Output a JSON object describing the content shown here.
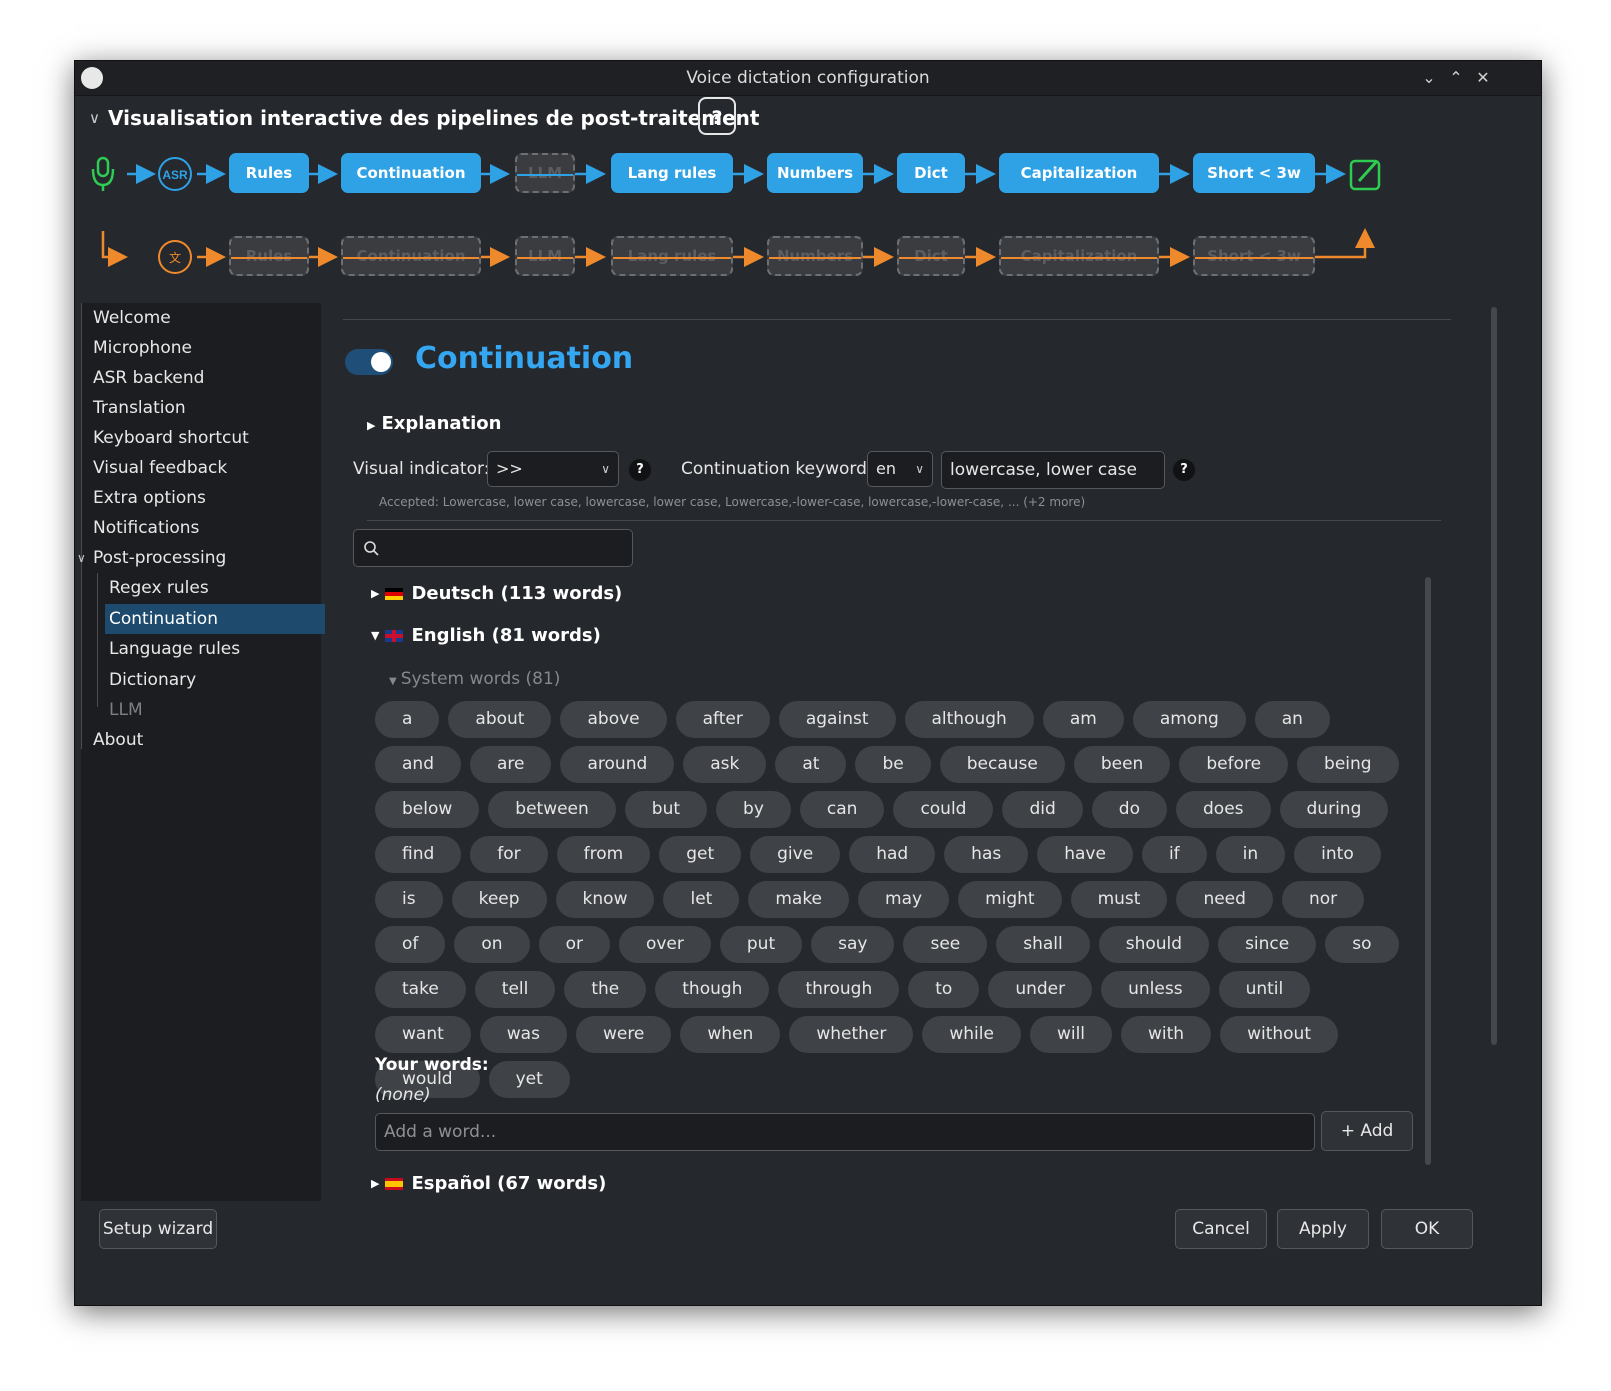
{
  "window": {
    "title": "Voice dictation configuration"
  },
  "pipeline": {
    "title": "Visualisation interactive des pipelines de post-traitement",
    "help": "?",
    "asr_label": "ASR",
    "main_stages": [
      "Rules",
      "Continuation",
      "LLM",
      "Lang rules",
      "Numbers",
      "Dict",
      "Capitalization",
      "Short < 3w"
    ],
    "main_stage_enabled": [
      true,
      true,
      false,
      true,
      true,
      true,
      true,
      true
    ],
    "translation_stages": [
      "Rules",
      "Continuation",
      "LLM",
      "Lang rules",
      "Numbers",
      "Dict",
      "Capitalization",
      "Short < 3w"
    ],
    "colors": {
      "main": "#2fa2e6",
      "translation": "#ef8a2c",
      "mic": "#2ecc52"
    }
  },
  "sidebar": {
    "items": [
      "Welcome",
      "Microphone",
      "ASR backend",
      "Translation",
      "Keyboard shortcut",
      "Visual feedback",
      "Extra options",
      "Notifications",
      "Post-processing"
    ],
    "post_processing_children": [
      "Regex rules",
      "Continuation",
      "Language rules",
      "Dictionary",
      "LLM"
    ],
    "after": [
      "About"
    ],
    "selected": "Continuation"
  },
  "section": {
    "title": "Continuation",
    "enabled": true,
    "explanation": "Explanation",
    "visual_indicator_label": "Visual indicator:",
    "visual_indicator_value": ">>",
    "keyword_label": "Continuation keyword:",
    "keyword_lang": "en",
    "keyword_value": "lowercase, lower case",
    "accepted": "Accepted: Lowercase, lower case, lowercase, lower case, Lowercase,-lower-case, lowercase,-lower-case, ... (+2 more)"
  },
  "languages": {
    "deutsch": "Deutsch (113 words)",
    "english": "English (81 words)",
    "system_words": "System words (81)",
    "espanol": "Español (67 words)"
  },
  "english_words": [
    "a",
    "about",
    "above",
    "after",
    "against",
    "although",
    "am",
    "among",
    "an",
    "and",
    "are",
    "around",
    "ask",
    "at",
    "be",
    "because",
    "been",
    "before",
    "being",
    "below",
    "between",
    "but",
    "by",
    "can",
    "could",
    "did",
    "do",
    "does",
    "during",
    "find",
    "for",
    "from",
    "get",
    "give",
    "had",
    "has",
    "have",
    "if",
    "in",
    "into",
    "is",
    "keep",
    "know",
    "let",
    "make",
    "may",
    "might",
    "must",
    "need",
    "nor",
    "of",
    "on",
    "or",
    "over",
    "put",
    "say",
    "see",
    "shall",
    "should",
    "since",
    "so",
    "take",
    "tell",
    "the",
    "though",
    "through",
    "to",
    "under",
    "unless",
    "until",
    "want",
    "was",
    "were",
    "when",
    "whether",
    "while",
    "will",
    "with",
    "without",
    "would",
    "yet"
  ],
  "your_words": {
    "label": "Your words:",
    "none": "(none)",
    "placeholder": "Add a word...",
    "add_button": "+ Add"
  },
  "footer": {
    "setup_wizard": "Setup wizard",
    "cancel": "Cancel",
    "apply": "Apply",
    "ok": "OK"
  }
}
